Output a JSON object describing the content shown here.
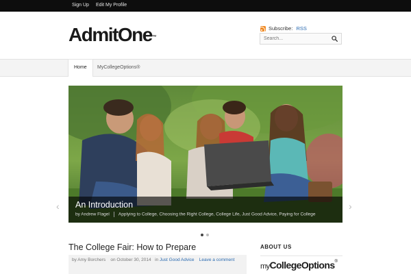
{
  "topbar": {
    "signup": "Sign Up",
    "edit_profile": "Edit My Profile"
  },
  "header": {
    "logo_text": "AdmitOne",
    "logo_tm": "™",
    "subscribe_label": "Subscribe:",
    "rss_link": "RSS",
    "search_placeholder": "Search..."
  },
  "nav": {
    "items": [
      {
        "label": "Home"
      },
      {
        "label": "MyCollegeOptions®"
      }
    ]
  },
  "slider": {
    "title": "An Introduction",
    "author": "by Andrew Flagel",
    "categories": "Applying to College, Choosing the Right College, College Life, Just Good Advice, Paying for College",
    "prev_arrow": "‹",
    "next_arrow": "›"
  },
  "post": {
    "title": "The College Fair: How to Prepare",
    "author": "by Amy Borchers",
    "date": "on October 30, 2014",
    "in_label": "in",
    "category": "Just Good Advice",
    "comment_link": "Leave a comment"
  },
  "sidebar": {
    "about_heading": "ABOUT US",
    "mco_logo_my": "my",
    "mco_logo_main": "CollegeOptions",
    "mco_logo_reg": "®"
  },
  "colors": {
    "accent_link": "#2a6ab0",
    "topbar_bg": "#0d0d0d",
    "rss_orange": "#f08a24"
  }
}
